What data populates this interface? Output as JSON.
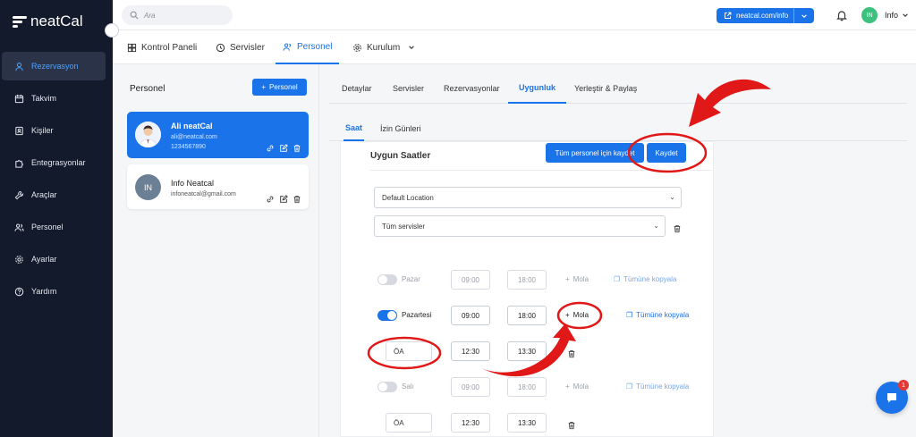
{
  "app": {
    "logo_text": "neatCal"
  },
  "sidebar": {
    "items": [
      {
        "label": "Rezervasyon",
        "icon": "user-icon",
        "active": true
      },
      {
        "label": "Takvim",
        "icon": "calendar-icon"
      },
      {
        "label": "Kişiler",
        "icon": "contacts-icon"
      },
      {
        "label": "Entegrasyonlar",
        "icon": "puzzle-icon"
      },
      {
        "label": "Araçlar",
        "icon": "wrench-icon"
      },
      {
        "label": "Personel",
        "icon": "users-icon"
      },
      {
        "label": "Ayarlar",
        "icon": "gear-icon"
      },
      {
        "label": "Yardım",
        "icon": "help-icon"
      }
    ]
  },
  "topbar": {
    "search_placeholder": "Ara",
    "url_label": "neatcal.com/info",
    "avatar_initials": "IN",
    "user_name": "Info"
  },
  "main_tabs": [
    {
      "label": "Kontrol Paneli"
    },
    {
      "label": "Servisler"
    },
    {
      "label": "Personel",
      "active": true
    },
    {
      "label": "Kurulum"
    }
  ],
  "personnel": {
    "title": "Personel",
    "add_button": "Personel",
    "cards": [
      {
        "name": "Ali neatCal",
        "email": "ali@neatcal.com",
        "phone": "1234567890",
        "active": true
      },
      {
        "name": "Info Neatcal",
        "email": "infoneatcal@gmail.com",
        "initials": "IN"
      }
    ]
  },
  "sub_tabs": [
    {
      "label": "Detaylar"
    },
    {
      "label": "Servisler"
    },
    {
      "label": "Rezervasyonlar"
    },
    {
      "label": "Uygunluk",
      "active": true
    },
    {
      "label": "Yerleştir & Paylaş"
    }
  ],
  "inner_tabs": [
    {
      "label": "Saat",
      "active": true
    },
    {
      "label": "İzin Günleri"
    }
  ],
  "availability": {
    "title": "Uygun Saatler",
    "save_all_button": "Tüm personel için kaydet",
    "save_button": "Kaydet",
    "location_select": "Default Location",
    "service_select": "Tüm servisler",
    "break_label": "Mola",
    "copy_label": "Tümüne kopyala",
    "days": [
      {
        "name": "Pazar",
        "enabled": false,
        "start": "09:00",
        "end": "18:00"
      },
      {
        "name": "Pazartesi",
        "enabled": true,
        "start": "09:00",
        "end": "18:00"
      },
      {
        "name": "Salı",
        "enabled": false,
        "start": "09:00",
        "end": "18:00"
      }
    ],
    "breaks": [
      {
        "label": "ÖA",
        "start": "12:30",
        "end": "13:30"
      },
      {
        "label": "ÖA",
        "start": "12:30",
        "end": "13:30"
      }
    ]
  },
  "chat": {
    "badge": "1"
  },
  "colors": {
    "primary": "#1a73e8",
    "sidebar": "#131a2b",
    "annotation": "#e01818"
  }
}
